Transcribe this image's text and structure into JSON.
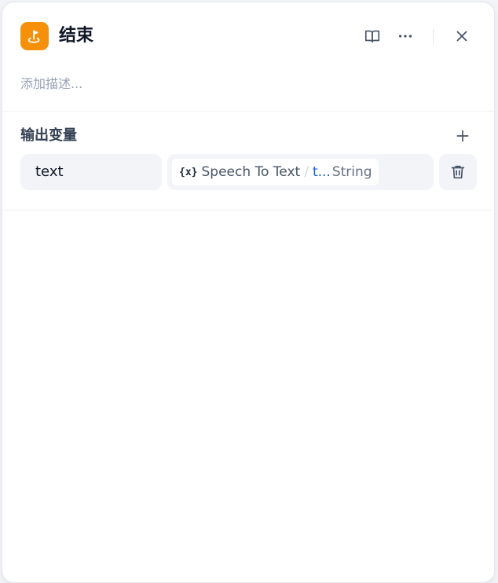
{
  "panel": {
    "title": "结束",
    "description_placeholder": "添加描述...",
    "accent_color": "#f79009"
  },
  "header_actions": [
    {
      "icon": "book-open-icon",
      "label": "help"
    },
    {
      "icon": "more-horizontal-icon",
      "label": "more"
    },
    {
      "icon": "close-icon",
      "label": "close"
    }
  ],
  "outputs": {
    "section_title": "输出变量",
    "add_icon": "plus-icon",
    "items": [
      {
        "name": "text",
        "ref_icon": "{x}",
        "ref_node": "Speech To Text",
        "ref_separator": "/",
        "ref_variable": "t...",
        "ref_type": "String",
        "delete_icon": "trash-icon"
      }
    ]
  }
}
